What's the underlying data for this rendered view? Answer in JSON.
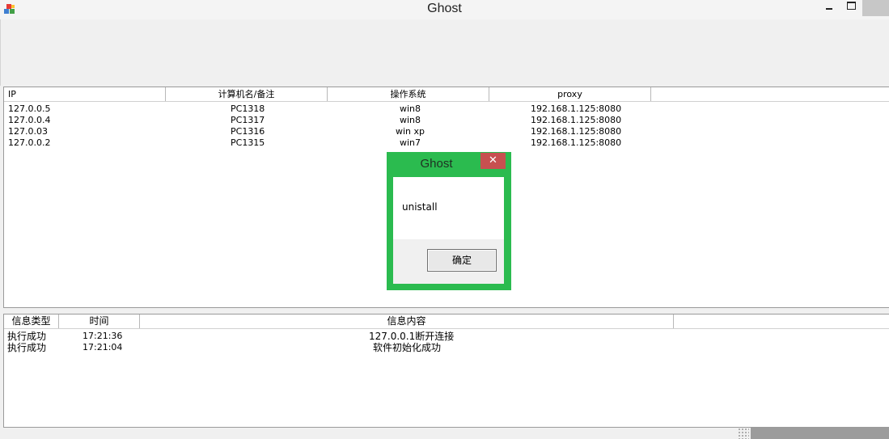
{
  "window": {
    "title": "Ghost",
    "icon": "app-cubes-icon",
    "controls": {
      "minimize": "minimize-icon",
      "maximize": "maximize-icon",
      "close": "close-icon"
    }
  },
  "host_list": {
    "columns": [
      "IP",
      "计算机名/备注",
      "操作系统",
      "proxy",
      ""
    ],
    "rows": [
      {
        "ip": "127.0.0.5",
        "name": "PC1318",
        "os": "win8",
        "proxy": "192.168.1.125:8080"
      },
      {
        "ip": "127.0.0.4",
        "name": "PC1317",
        "os": "win8",
        "proxy": "192.168.1.125:8080"
      },
      {
        "ip": "127.0.03",
        "name": "PC1316",
        "os": "win xp",
        "proxy": "192.168.1.125:8080"
      },
      {
        "ip": "127.0.0.2",
        "name": "PC1315",
        "os": "win7",
        "proxy": "192.168.1.125:8080"
      }
    ]
  },
  "log_list": {
    "columns": [
      "信息类型",
      "时间",
      "信息内容",
      ""
    ],
    "rows": [
      {
        "type": "执行成功",
        "time": "17:21:36",
        "content": "127.0.0.1断开连接"
      },
      {
        "type": "执行成功",
        "time": "17:21:04",
        "content": "软件初始化成功"
      }
    ]
  },
  "dialog": {
    "title": "Ghost",
    "message": "unistall",
    "ok_label": "确定",
    "close_symbol": "✕",
    "accent_color": "#2bbb4f",
    "close_color": "#c75050"
  }
}
